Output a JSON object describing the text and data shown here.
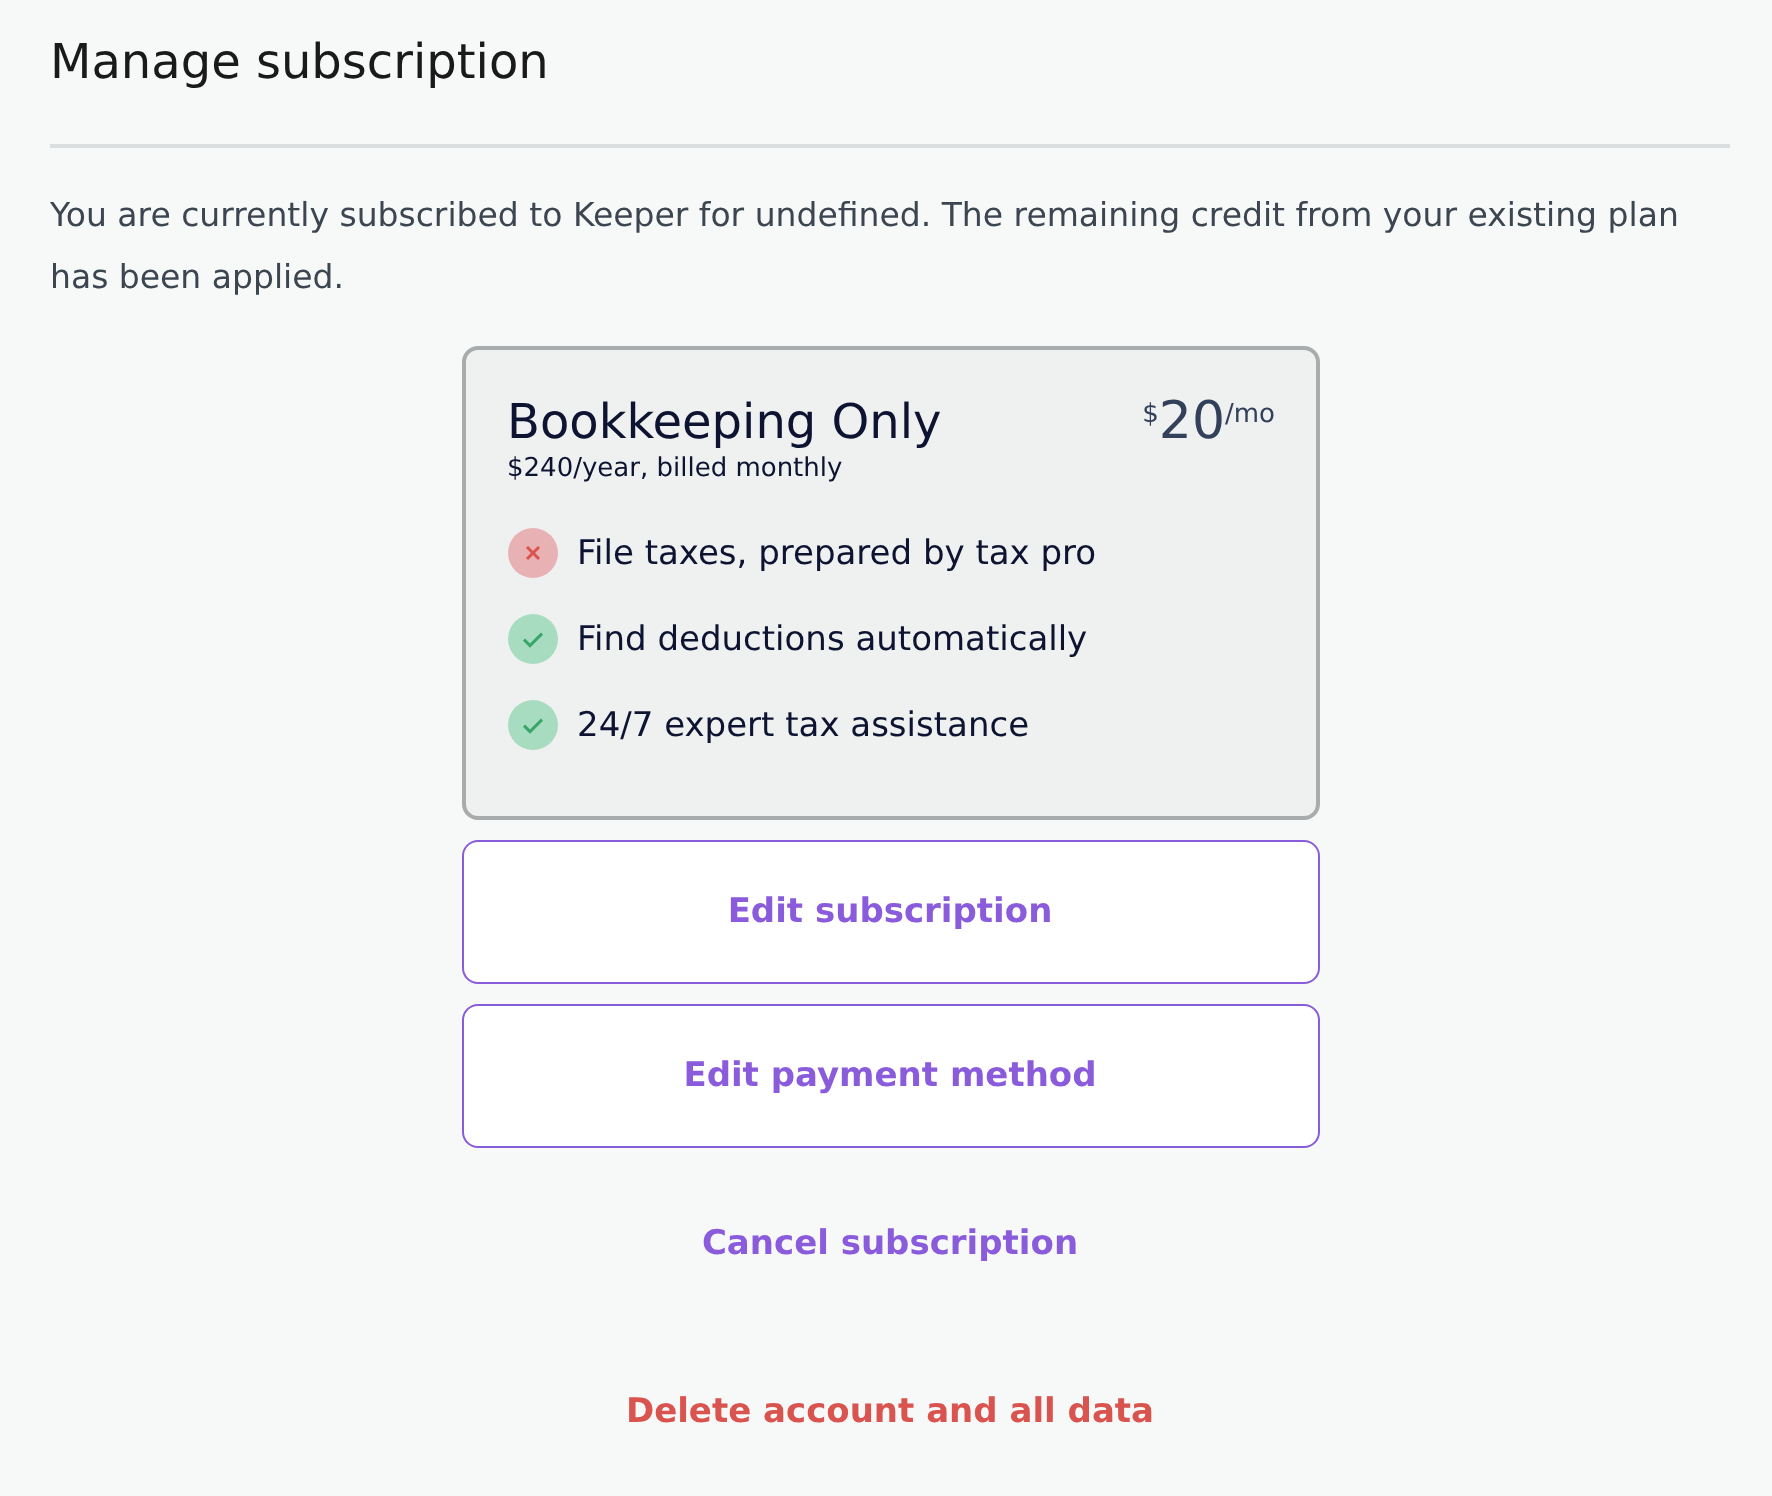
{
  "title": "Manage subscription",
  "description": "You are currently subscribed to Keeper for undefined. The remaining credit from your existing plan has been applied.",
  "plan": {
    "name": "Bookkeeping Only",
    "billing": "$240/year, billed monthly",
    "currency": "$",
    "amount": "20",
    "period": "/mo",
    "features": [
      {
        "label": "File taxes, prepared by tax pro",
        "included": false
      },
      {
        "label": "Find deductions automatically",
        "included": true
      },
      {
        "label": "24/7 expert tax assistance",
        "included": true
      }
    ]
  },
  "actions": [
    {
      "label": "Edit subscription",
      "kind": "outline"
    },
    {
      "label": "Edit payment method",
      "kind": "outline"
    },
    {
      "label": "Cancel subscription",
      "kind": "link"
    },
    {
      "label": "Delete account and all data",
      "kind": "danger"
    }
  ]
}
